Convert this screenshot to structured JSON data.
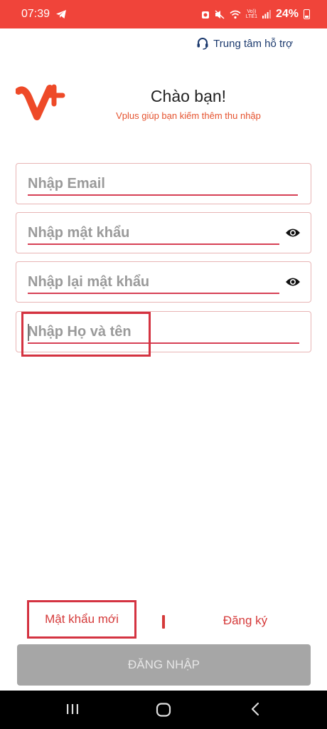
{
  "status_bar": {
    "time": "07:39",
    "volte": "Vo))",
    "lte": "LTE1",
    "battery": "24%"
  },
  "header": {
    "support_label": "Trung tâm hỗ trợ"
  },
  "brand": {
    "logo_text": "V+",
    "greeting": "Chào bạn!",
    "subtitle": "Vplus giúp bạn kiếm thêm thu nhập",
    "accent": "#e5532f"
  },
  "form": {
    "email_placeholder": "Nhập Email",
    "password_placeholder": "Nhập mật khẩu",
    "confirm_password_placeholder": "Nhập lại mật khẩu",
    "fullname_placeholder": "Nhập Họ và tên"
  },
  "links": {
    "new_password": "Mật khẩu mới",
    "register": "Đăng ký"
  },
  "login_button": "ĐĂNG NHẬP",
  "colors": {
    "status_bar": "#f0443a",
    "link": "#d53a3a",
    "highlight": "#d43341",
    "button_disabled": "#a6a6a6"
  }
}
